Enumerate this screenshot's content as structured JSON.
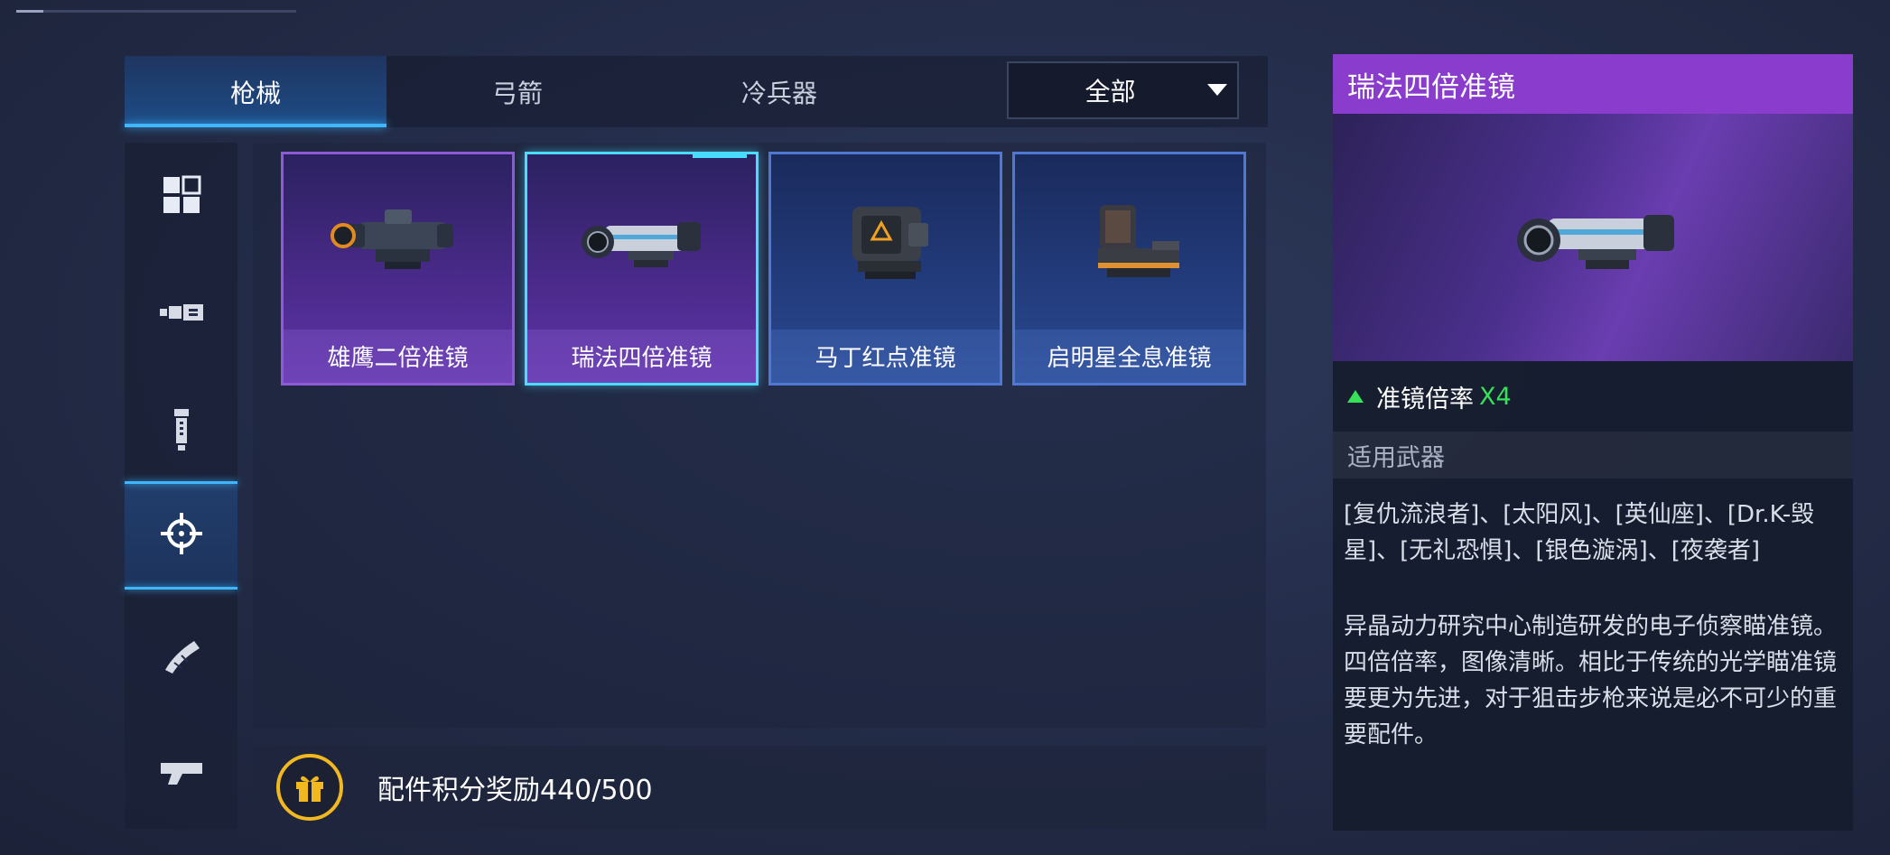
{
  "tabs": [
    {
      "label": "枪械",
      "active": true
    },
    {
      "label": "弓箭",
      "active": false
    },
    {
      "label": "冷兵器",
      "active": false
    }
  ],
  "filter": {
    "selected": "全部"
  },
  "side_icons": [
    "all-category-icon",
    "barrel-icon",
    "grip-icon",
    "scope-crosshair-icon",
    "magazine-icon",
    "stock-icon"
  ],
  "items": [
    {
      "name": "雄鹰二倍准镜",
      "rarity": "purple"
    },
    {
      "name": "瑞法四倍准镜",
      "rarity": "purple",
      "selected": true
    },
    {
      "name": "马丁红点准镜",
      "rarity": "blue"
    },
    {
      "name": "启明星全息准镜",
      "rarity": "blue"
    }
  ],
  "reward": {
    "text": "配件积分奖励440/500"
  },
  "detail": {
    "title": "瑞法四倍准镜",
    "stat_label": "准镜倍率",
    "stat_value": "X4",
    "weapons_header": "适用武器",
    "weapons": "[复仇流浪者]、[太阳风]、[英仙座]、[Dr.K-毁星]、[无礼恐惧]、[银色漩涡]、[夜袭者]",
    "description": "异晶动力研究中心制造研发的电子侦察瞄准镜。四倍倍率，图像清晰。相比于传统的光学瞄准镜要更为先进，对于狙击步枪来说是必不可少的重要配件。"
  },
  "colors": {
    "accent": "#3fb6ff",
    "purple_rarity": "#8a3ccc",
    "blue_rarity": "#4f78d2",
    "stat_green": "#38e05a",
    "gift_gold": "#f2b820"
  }
}
